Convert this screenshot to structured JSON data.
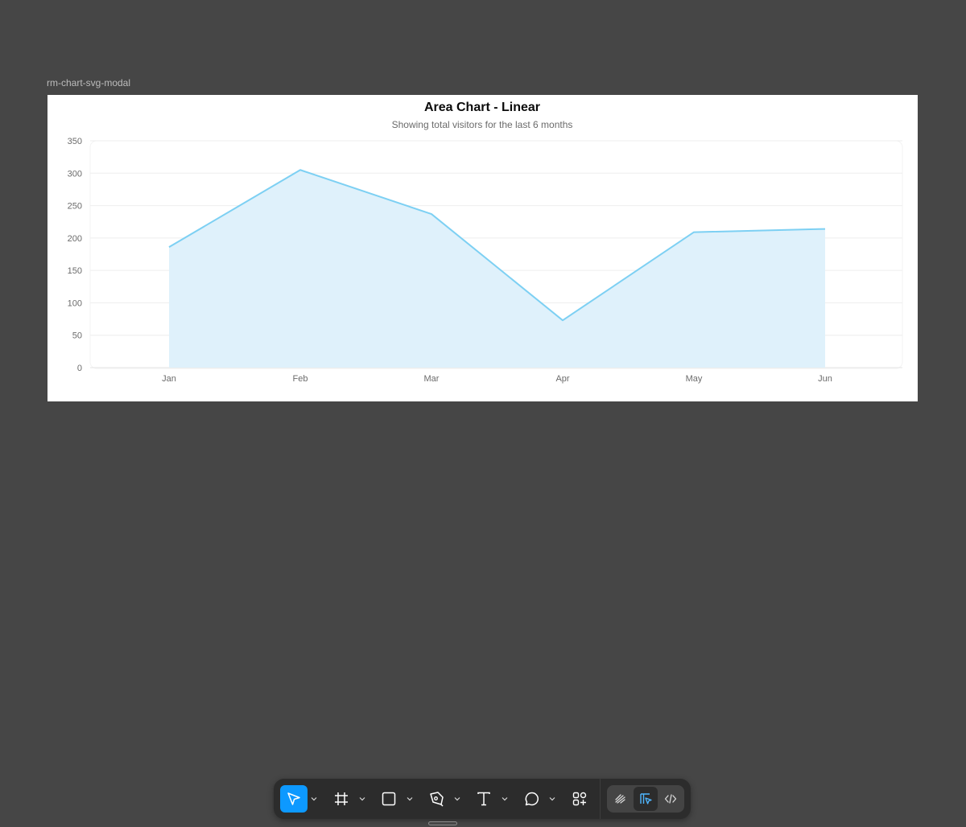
{
  "frame": {
    "label": "rm-chart-svg-modal"
  },
  "chart_data": {
    "type": "area",
    "title": "Area Chart - Linear",
    "subtitle": "Showing total visitors for the last 6 months",
    "categories": [
      "Jan",
      "Feb",
      "Mar",
      "Apr",
      "May",
      "Jun"
    ],
    "series": [
      {
        "values": [
          186,
          305,
          237,
          73,
          209,
          214
        ]
      }
    ],
    "ylim": [
      0,
      350
    ],
    "yticks": [
      0,
      50,
      100,
      150,
      200,
      250,
      300,
      350
    ],
    "grid": true,
    "xlabel": "",
    "ylabel": "",
    "colors": {
      "line": "#7dd0f3",
      "fill": "#dff1fb",
      "grid": "#eeeeee"
    }
  },
  "toolbar": {
    "tools": [
      {
        "name": "move-tool",
        "icon": "cursor-arrow-icon",
        "active": true
      },
      {
        "name": "frame-tool",
        "icon": "frame-hash-icon",
        "active": false
      },
      {
        "name": "rectangle-tool",
        "icon": "square-icon",
        "active": false
      },
      {
        "name": "pen-tool",
        "icon": "pen-nib-icon",
        "active": false
      },
      {
        "name": "text-tool",
        "icon": "text-t-icon",
        "active": false
      },
      {
        "name": "comment-tool",
        "icon": "speech-bubble-icon",
        "active": false
      },
      {
        "name": "actions-tool",
        "icon": "shapes-plus-icon",
        "active": false
      }
    ],
    "modes": [
      {
        "name": "draw-mode",
        "icon": "draw-squiggle-icon",
        "active": false
      },
      {
        "name": "design-mode",
        "icon": "design-layout-icon",
        "active": true
      },
      {
        "name": "dev-mode",
        "icon": "code-brackets-icon",
        "active": false
      }
    ],
    "accent": "#0d99ff"
  }
}
